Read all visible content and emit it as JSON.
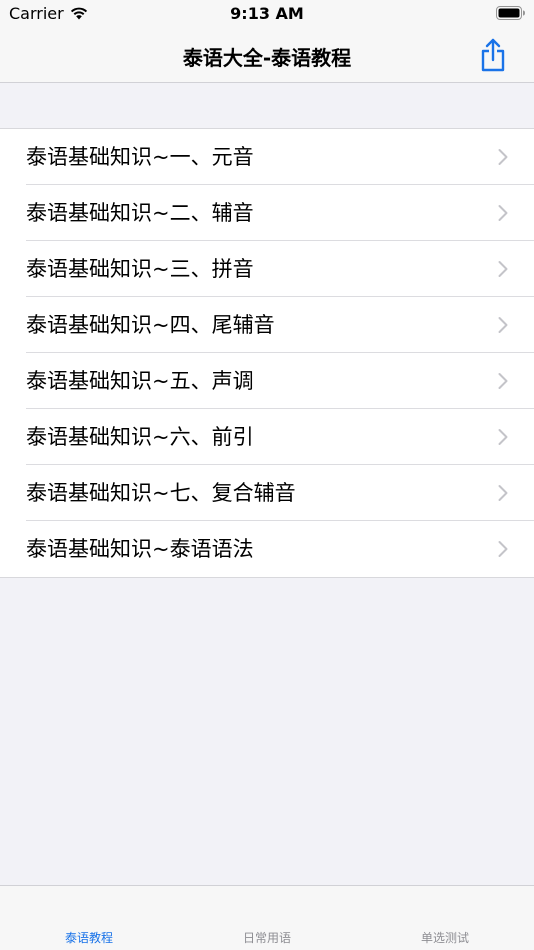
{
  "status_bar": {
    "carrier": "Carrier",
    "time": "9:13 AM",
    "icons": [
      "wifi-icon",
      "battery-icon"
    ]
  },
  "nav": {
    "title": "泰语大全-泰语教程",
    "share_icon": "share-icon",
    "accent_color": "#1a73e8"
  },
  "list": {
    "items": [
      {
        "label": "泰语基础知识~一、元音"
      },
      {
        "label": "泰语基础知识~二、辅音"
      },
      {
        "label": "泰语基础知识~三、拼音"
      },
      {
        "label": "泰语基础知识~四、尾辅音"
      },
      {
        "label": "泰语基础知识~五、声调"
      },
      {
        "label": "泰语基础知识~六、前引"
      },
      {
        "label": "泰语基础知识~七、复合辅音"
      },
      {
        "label": "泰语基础知识~泰语语法"
      }
    ],
    "chevron_icon": "chevron-right-icon"
  },
  "tab_bar": {
    "tabs": [
      {
        "label": "泰语教程",
        "active": true
      },
      {
        "label": "日常用语",
        "active": false
      },
      {
        "label": "单选测试",
        "active": false
      }
    ]
  }
}
